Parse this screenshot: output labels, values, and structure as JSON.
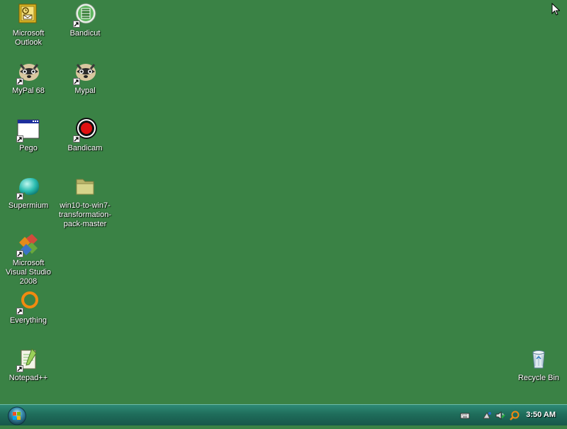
{
  "desktop": {
    "background_color": "#3a8245",
    "icons": [
      {
        "label": "Microsoft Outlook",
        "icon": "outlook-icon"
      },
      {
        "label": "Bandicut",
        "icon": "bandicut-icon"
      },
      {
        "label": "MyPal 68",
        "icon": "mypal-icon"
      },
      {
        "label": "Mypal",
        "icon": "mypal-icon"
      },
      {
        "label": "Pego",
        "icon": "window-app-icon"
      },
      {
        "label": "Bandicam",
        "icon": "bandicam-icon"
      },
      {
        "label": "Supermium",
        "icon": "supermium-icon"
      },
      {
        "label": "win10-to-win7-transformation-pack-master",
        "icon": "folder-icon"
      },
      {
        "label": "Microsoft Visual Studio 2008",
        "icon": "visual-studio-icon"
      },
      {
        "label": "Everything",
        "icon": "everything-icon"
      },
      {
        "label": "Notepad++",
        "icon": "notepadpp-icon"
      },
      {
        "label": "Recycle Bin",
        "icon": "recycle-bin-icon"
      }
    ]
  },
  "taskbar": {
    "start_icon": "windows-orb-icon",
    "tray_icons": [
      "keyboard-icon",
      "network-icon",
      "volume-icon",
      "search-icon"
    ],
    "clock": "3:50 AM"
  }
}
